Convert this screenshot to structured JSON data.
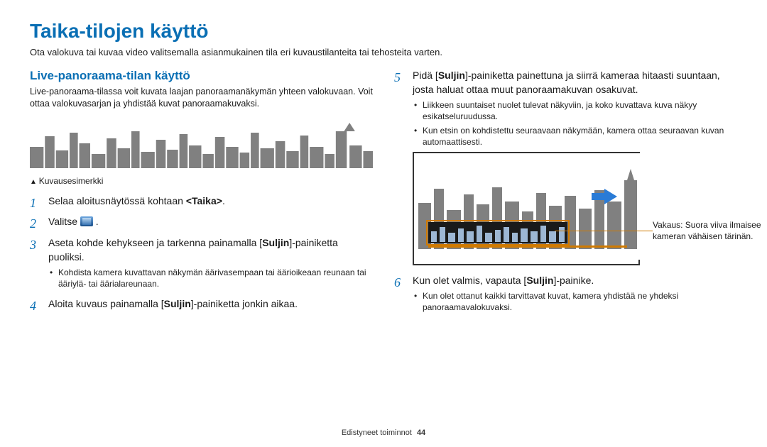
{
  "title": "Taika-tilojen käyttö",
  "intro": "Ota valokuva tai kuvaa video valitsemalla asianmukainen tila eri kuvaustilanteita tai tehosteita varten.",
  "section": {
    "heading": "Live-panoraama-tilan käyttö",
    "p1": "Live-panoraama-tilassa voit kuvata laajan panoraamanäkymän yhteen valokuvaan. Voit ottaa valokuvasarjan ja yhdistää kuvat panoraamakuvaksi.",
    "caption": "Kuvausesimerkki"
  },
  "steps": [
    {
      "pre": "Selaa aloitusnäytössä kohtaan ",
      "bold": "<Taika>",
      "post": "."
    },
    {
      "pre": "Valitse ",
      "icon": true,
      "post": " ."
    },
    {
      "pre": "Aseta kohde kehykseen ja tarkenna painamalla [",
      "bold": "Suljin",
      "post": "]-painiketta puoliksi.",
      "sub": [
        "Kohdista kamera kuvattavan näkymän äärivasempaan tai äärioikeaan reunaan tai ääriylä- tai äärialareunaan."
      ]
    },
    {
      "pre": "Aloita kuvaus painamalla [",
      "bold": "Suljin",
      "post": "]-painiketta jonkin aikaa."
    },
    {
      "pre": "Pidä [",
      "bold": "Suljin",
      "post": "]-painiketta painettuna ja siirrä kameraa hitaasti suuntaan, josta haluat ottaa muut panoraamakuvan osakuvat.",
      "sub": [
        "Liikkeen suuntaiset nuolet tulevat näkyviin, ja koko kuvattava kuva näkyy esikatseluruudussa.",
        "Kun etsin on kohdistettu seuraavaan näkymään, kamera ottaa seuraavan kuvan automaattisesti."
      ],
      "annot": "Vakaus: Suora viiva ilmaisee kameran vähäisen tärinän."
    },
    {
      "pre": "Kun olet valmis, vapauta [",
      "bold": "Suljin",
      "post": "]-painike.",
      "sub": [
        "Kun olet ottanut kaikki tarvittavat kuvat, kamera yhdistää ne yhdeksi panoraamavalokuvaksi."
      ]
    }
  ],
  "footer": {
    "section": "Edistyneet toiminnot",
    "page": "44"
  }
}
